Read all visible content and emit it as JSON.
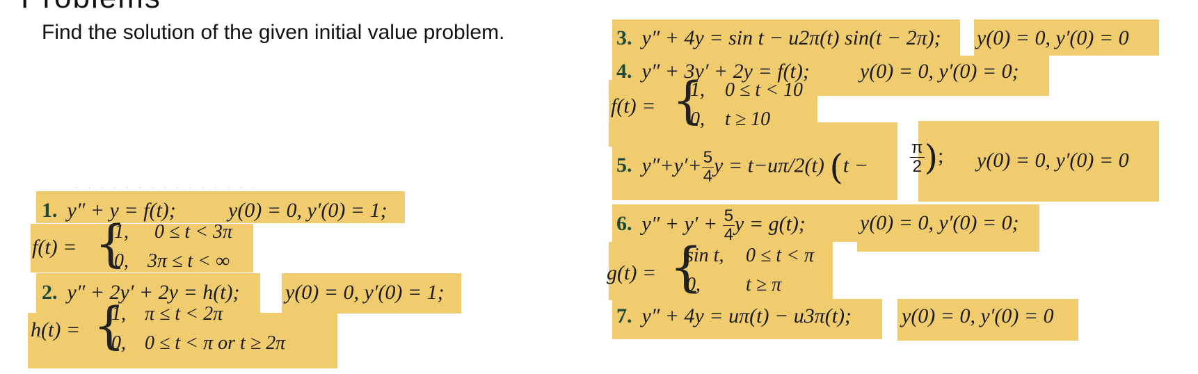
{
  "header": {
    "title_fragment": "Problems",
    "instruction": "Find the solution of the given initial value problem."
  },
  "problems": [
    {
      "number": "1.",
      "equation": "y″ + y = f(t);",
      "conditions": "y(0) = 0,  y′(0) = 1;",
      "func_lhs": "f(t) =",
      "cases": [
        {
          "value": "1,",
          "condition": "0 ≤ t < 3π"
        },
        {
          "value": "0,",
          "condition": "3π  ≤ t < ∞"
        }
      ]
    },
    {
      "number": "2.",
      "equation": "y″ + 2y′ + 2y = h(t);",
      "conditions": "y(0) = 0,  y′(0) = 1;",
      "func_lhs": "h(t) =",
      "cases": [
        {
          "value": "1,",
          "condition": "π ≤ t < 2π"
        },
        {
          "value": "0,",
          "condition": "0 ≤ t < π   or   t ≥ 2π"
        }
      ]
    },
    {
      "number": "3.",
      "equation": "y″ + 4y = sin t − u2π(t) sin(t − 2π);",
      "conditions": "y(0) = 0,  y′(0) = 0"
    },
    {
      "number": "4.",
      "equation": "y″ + 3y′ + 2y = f(t);",
      "conditions": "y(0) = 0,  y′(0) = 0;",
      "func_lhs": "f(t) =",
      "cases": [
        {
          "value": "1,",
          "condition": "0 ≤ t < 10"
        },
        {
          "value": "0,",
          "condition": "t ≥ 10"
        }
      ]
    },
    {
      "number": "5.",
      "equation_prefix": "y″+y′+",
      "frac_num": "5",
      "frac_den": "4",
      "equation_mid": "y = t−uπ/2(t)",
      "inner_t": "t −",
      "inner_frac_num": "π",
      "inner_frac_den": "2",
      "semicolon": ";",
      "conditions": "y(0) = 0,  y′(0) = 0"
    },
    {
      "number": "6.",
      "equation_prefix": "y″ + y′ +",
      "frac_num": "5",
      "frac_den": "4",
      "equation_mid": "y = g(t);",
      "conditions": "y(0) = 0,  y′(0) = 0;",
      "func_lhs": "g(t) =",
      "cases": [
        {
          "value": "sin t,",
          "condition": "0 ≤ t < π"
        },
        {
          "value": "0,",
          "condition": "t ≥ π"
        }
      ]
    },
    {
      "number": "7.",
      "equation": "y″ + 4y = uπ(t) − u3π(t);",
      "conditions": "y(0) = 0,  y′(0) = 0"
    }
  ],
  "highlight_color": "#f0cc6e"
}
